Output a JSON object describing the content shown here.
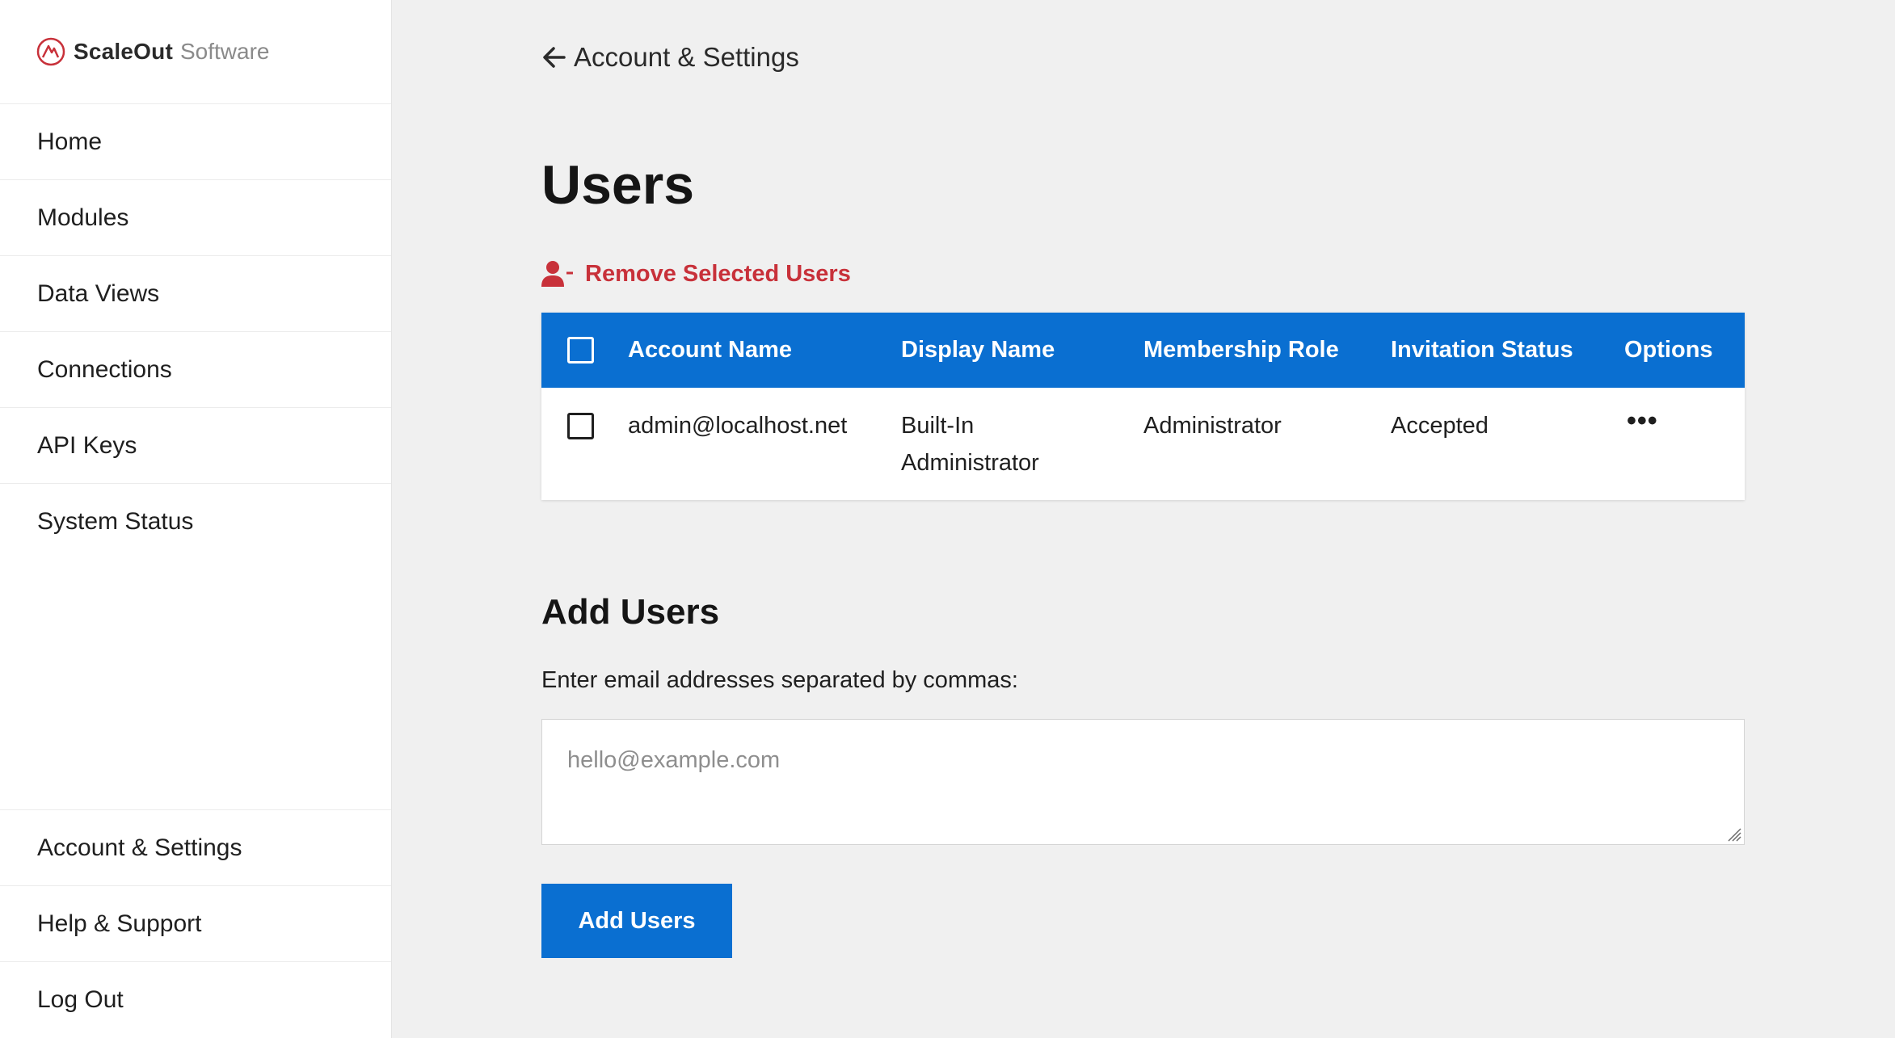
{
  "brand": {
    "name": "ScaleOut",
    "sub": "Software",
    "logo_icon": "mountain-circle-logo",
    "accent": "#c8313a"
  },
  "sidebar": {
    "items": [
      {
        "label": "Home"
      },
      {
        "label": "Modules"
      },
      {
        "label": "Data Views"
      },
      {
        "label": "Connections"
      },
      {
        "label": "API Keys"
      },
      {
        "label": "System Status"
      }
    ],
    "bottom_items": [
      {
        "label": "Account & Settings"
      },
      {
        "label": "Help & Support"
      },
      {
        "label": "Log Out"
      }
    ]
  },
  "header": {
    "back_label": "Account & Settings",
    "back_icon": "arrow-left-icon"
  },
  "page": {
    "title": "Users"
  },
  "actions": {
    "remove_label": "Remove Selected Users",
    "remove_icon": "user-minus-icon",
    "remove_color": "#c8313a"
  },
  "table": {
    "header_color": "#0a6fd1",
    "columns": [
      "Account Name",
      "Display Name",
      "Membership Role",
      "Invitation Status",
      "Options"
    ],
    "rows": [
      {
        "account": "admin@localhost.net",
        "display_line1": "Built-In",
        "display_line2": "Administrator",
        "role": "Administrator",
        "status": "Accepted",
        "options_icon": "ellipsis-icon"
      }
    ]
  },
  "add_users": {
    "title": "Add Users",
    "label": "Enter email addresses separated by commas:",
    "placeholder": "hello@example.com",
    "value": "",
    "button_label": "Add Users"
  }
}
